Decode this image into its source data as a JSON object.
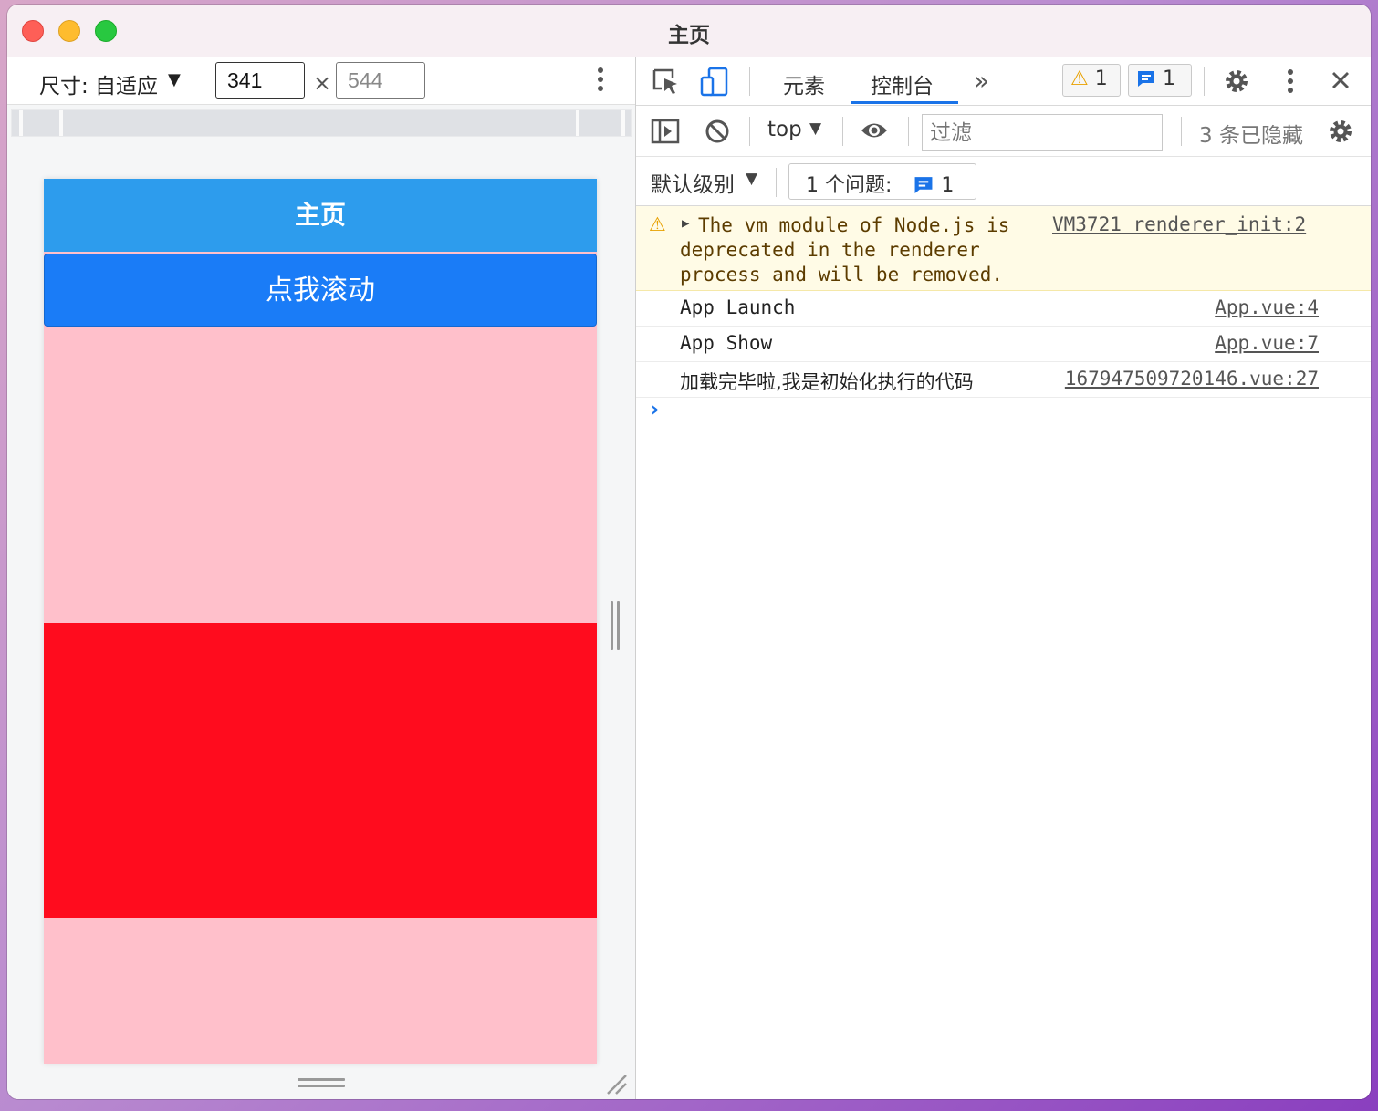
{
  "window": {
    "title": "主页"
  },
  "device_toolbar": {
    "dimensions_label": "尺寸: 自适应",
    "width_value": "341",
    "height_value": "544",
    "times_symbol": "×"
  },
  "app": {
    "nav_title": "主页",
    "scroll_button_label": "点我滚动",
    "colors": {
      "nav": "#2d9ced",
      "button": "#1a7cf7",
      "pink": "#ffc0cb",
      "red": "#ff0c1e"
    }
  },
  "devtools": {
    "tabs": [
      "元素",
      "控制台"
    ],
    "more_tabs_symbol": "»",
    "warnings_count": "1",
    "messages_count": "1",
    "context": "top",
    "filter_placeholder": "过滤",
    "hidden_count_label": "3 条已隐藏",
    "default_level_label": "默认级别",
    "issues_label": "1 个问题:",
    "issues_count": "1",
    "console": {
      "warning": {
        "text": "The vm module of Node.js is deprecated in the renderer process and will be removed.",
        "source": "VM3721 renderer_init:2"
      },
      "logs": [
        {
          "text": "App Launch",
          "source": "App.vue:4"
        },
        {
          "text": "App Show",
          "source": "App.vue:7"
        },
        {
          "text": "加载完毕啦,我是初始化执行的代码",
          "source": "167947509720146.vue:27"
        }
      ],
      "prompt_symbol": "›"
    }
  }
}
